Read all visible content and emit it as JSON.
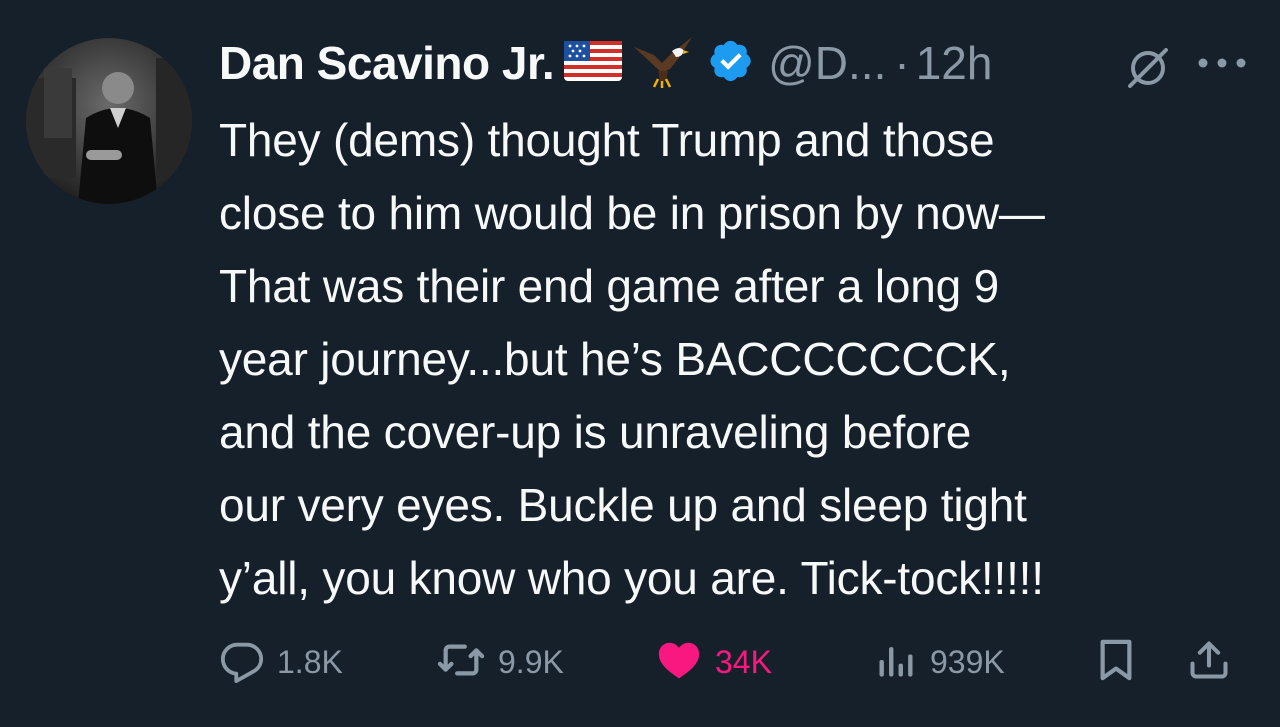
{
  "tweet": {
    "author": {
      "display_name": "Dan Scavino Jr.",
      "handle": "@D...",
      "verified": true,
      "emojis": [
        "flag-us-icon",
        "eagle-icon"
      ]
    },
    "separator": "·",
    "timestamp": "12h",
    "text": "They (dems) thought Trump and those\nclose to him would be in prison by now—\nThat was their end game after a long 9\nyear journey...but he’s BACCCCCCCK,\nand the cover-up is unraveling before\nour very eyes. Buckle up and sleep tight\ny’all, you know who you are. Tick-tock!!!!!",
    "actions": {
      "replies": "1.8K",
      "reposts": "9.9K",
      "likes": "34K",
      "views": "939K"
    },
    "liked": true
  },
  "colors": {
    "background": "#15202b",
    "text_primary": "#f7f9f9",
    "text_secondary": "#8b98a5",
    "verified_blue": "#1d9bf0",
    "like_pink": "#f91880"
  }
}
